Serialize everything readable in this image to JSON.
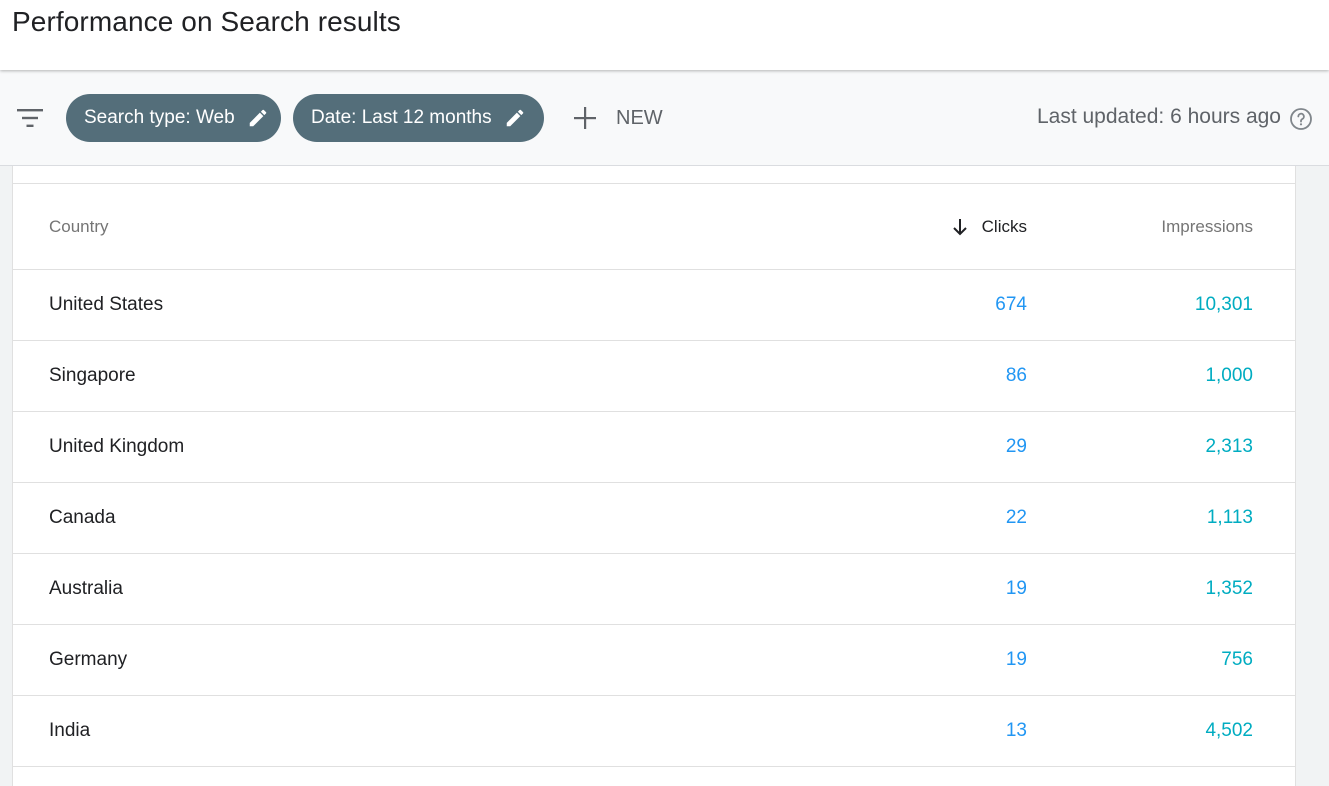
{
  "header": {
    "title": "Performance on Search results"
  },
  "toolbar": {
    "chips": [
      {
        "label": "Search type: Web"
      },
      {
        "label": "Date: Last 12 months"
      }
    ],
    "new_label": "NEW",
    "last_updated": "Last updated: 6 hours ago"
  },
  "table": {
    "columns": {
      "country": "Country",
      "clicks": "Clicks",
      "impressions": "Impressions"
    },
    "sorted_by": "clicks",
    "sort_direction": "descending",
    "rows": [
      {
        "country": "United States",
        "clicks": "674",
        "impressions": "10,301"
      },
      {
        "country": "Singapore",
        "clicks": "86",
        "impressions": "1,000"
      },
      {
        "country": "United Kingdom",
        "clicks": "29",
        "impressions": "2,313"
      },
      {
        "country": "Canada",
        "clicks": "22",
        "impressions": "1,113"
      },
      {
        "country": "Australia",
        "clicks": "19",
        "impressions": "1,352"
      },
      {
        "country": "Germany",
        "clicks": "19",
        "impressions": "756"
      },
      {
        "country": "India",
        "clicks": "13",
        "impressions": "4,502"
      }
    ]
  },
  "colors": {
    "chip_bg": "#546e7a",
    "clicks_value": "#2196f3",
    "impressions_value": "#00acc1"
  },
  "icons": [
    "filter-icon",
    "pencil-icon",
    "plus-icon",
    "help-icon",
    "arrow-down-icon"
  ]
}
